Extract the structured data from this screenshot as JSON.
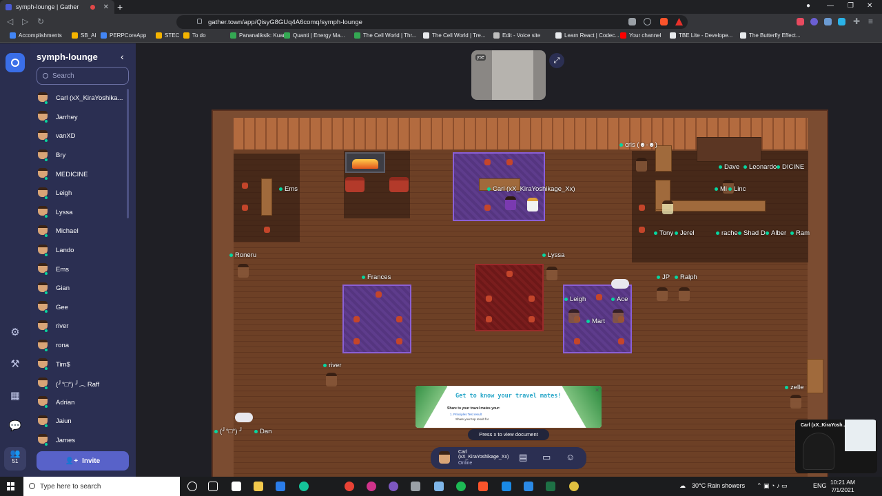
{
  "browser": {
    "tab_title": "symph-lounge | Gather",
    "url": "gather.town/app/QisyG8GUq4A6comq/symph-lounge",
    "bookmarks": [
      {
        "label": "Accomplishments",
        "color": "#4285f4"
      },
      {
        "label": "SB_AI",
        "color": "#f4b400"
      },
      {
        "label": "PERPCoreApp",
        "color": "#4285f4"
      },
      {
        "label": "STEC",
        "color": "#f4b400"
      },
      {
        "label": "To do",
        "color": "#f4b400"
      },
      {
        "label": "Pananaliksik: Kuan...",
        "color": "#34a853"
      },
      {
        "label": "Quanti | Energy Ma...",
        "color": "#34a853"
      },
      {
        "label": "The Cell World | Thr...",
        "color": "#34a853"
      },
      {
        "label": "The Cell World | Tre...",
        "color": "#e8eaed"
      },
      {
        "label": "Edit - Voice site",
        "color": "#bdbdbd"
      },
      {
        "label": "Learn React | Codec...",
        "color": "#e8eaed"
      },
      {
        "label": "Your channel",
        "color": "#ff0000"
      },
      {
        "label": "TBE Lite - Develope...",
        "color": "#e8eaed"
      },
      {
        "label": "The Butterfly Effect...",
        "color": "#e8eaed"
      }
    ]
  },
  "gather": {
    "space_name": "symph-lounge",
    "search_placeholder": "Search",
    "online_count": "51",
    "invite_label": "Invite",
    "members": [
      "Carl (xX_KiraYoshika...",
      "Jarrhey",
      "vanXD",
      "Bry",
      "MEDICINE",
      "Leigh",
      "Lyssa",
      "Michael",
      "Lando",
      "Ems",
      "Gian",
      "Gee",
      "river",
      "rona",
      "Tim$",
      "(╯°□°) ╯︵ Raff",
      "Adrian",
      "Jaiun",
      "James"
    ],
    "map_labels": {
      "cris": "cris (☻-☻)",
      "dave": "Dave",
      "leonardo": "Leonardo",
      "dicine": "DICINE",
      "ems": "Ems",
      "carl": "Carl (xX_KiraYoshikage_Xx)",
      "mi": "Mi",
      "linc": "Linc",
      "tony": "Tony",
      "jerel": "Jerel",
      "rache": "rache",
      "shad": "Shad D",
      "alber": "Alber",
      "ram": "Ram",
      "roneru": "Roneru",
      "lyssa": "Lyssa",
      "frances": "Frances",
      "jp": "JP",
      "ralph": "Ralph",
      "leigh": "Leigh",
      "ace": "Ace",
      "mart": "Mart",
      "river": "river",
      "zelle": "zelle",
      "raff": "(╯°□°) ╯",
      "dan": "Dan"
    },
    "video_tag": "yse",
    "popup": {
      "title": "Get to know your travel mates!",
      "subtitle": "Share to your travel mates your:",
      "item1": "1.   Principles Test result",
      "item2": "Share your top result for"
    },
    "hint": "Press x to view document",
    "me": {
      "name_line1": "Carl",
      "name_line2": "(xX_KiraYoshikage_Xx)",
      "status": "Online"
    },
    "selfview_name": "Carl (xX_KiraYosh..."
  },
  "taskbar": {
    "search_placeholder": "Type here to search",
    "weather": "30°C  Rain showers",
    "language": "ENG",
    "time": "10:21 AM",
    "date": "7/1/2021"
  }
}
